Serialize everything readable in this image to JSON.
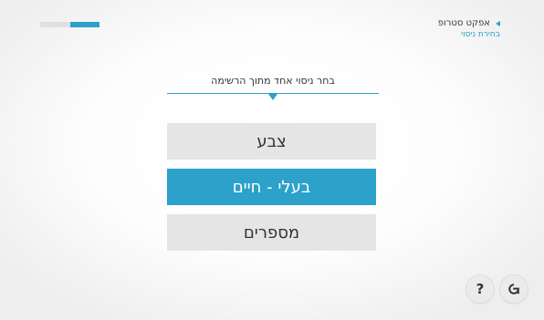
{
  "progress": {
    "value": 0.5
  },
  "breadcrumb": {
    "title": "אפקט סטרופ",
    "subtitle": "בחירת ניסוי"
  },
  "main": {
    "instruction": "בחר ניסוי אחד מתוך הרשימה",
    "options": [
      {
        "label": "צבע",
        "selected": false
      },
      {
        "label": "בעלי - חיים",
        "selected": true
      },
      {
        "label": "מספרים",
        "selected": false
      }
    ]
  },
  "controls": {
    "help_label": "?",
    "help_icon": "question-mark-icon",
    "reset_icon": "reset-arrow-icon"
  },
  "colors": {
    "accent": "#2ca1c9",
    "option_bg": "#e5e5e5",
    "text": "#333333"
  }
}
